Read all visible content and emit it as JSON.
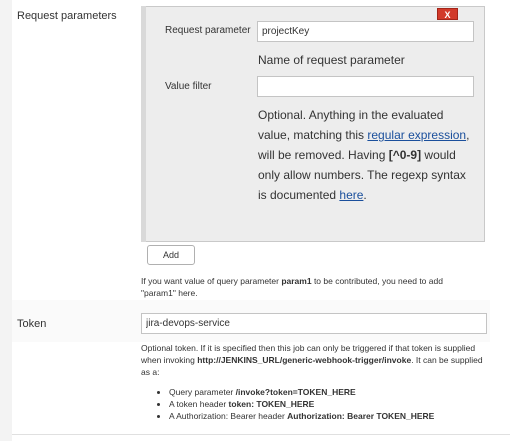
{
  "request_parameters": {
    "section_label": "Request parameters",
    "delete_label": "X",
    "request_parameter_label": "Request parameter",
    "request_parameter_value": "projectKey",
    "request_parameter_help": "Name of request parameter",
    "value_filter_label": "Value filter",
    "value_filter_value": "",
    "value_filter_help": {
      "part1": "Optional. Anything in the evaluated value, matching this ",
      "link1": "regular expression",
      "part2": ", will be removed. Having ",
      "code": "[^0-9]",
      "part3": " would only allow numbers. The regexp syntax is documented ",
      "link2": "here",
      "part4": "."
    },
    "add_label": "Add",
    "footer_help": {
      "part1": "If you want value of query parameter ",
      "param": "param1",
      "part2": " to be contributed, you need to add \"param1\" here."
    }
  },
  "token": {
    "section_label": "Token",
    "value": "jira-devops-service",
    "help": {
      "part1": "Optional token. If it is specified then this job can only be triggered if that token is supplied when invoking ",
      "url": "http://JENKINS_URL/generic-webhook-trigger/invoke",
      "part2": ". It can be supplied as a:"
    },
    "options": [
      {
        "prefix": "Query parameter ",
        "bold": "/invoke?token=TOKEN_HERE"
      },
      {
        "prefix": "A token header ",
        "bold": "token: TOKEN_HERE"
      },
      {
        "prefix": "A Authorization: Bearer header ",
        "bold": "Authorization: Bearer TOKEN_HERE"
      }
    ]
  }
}
